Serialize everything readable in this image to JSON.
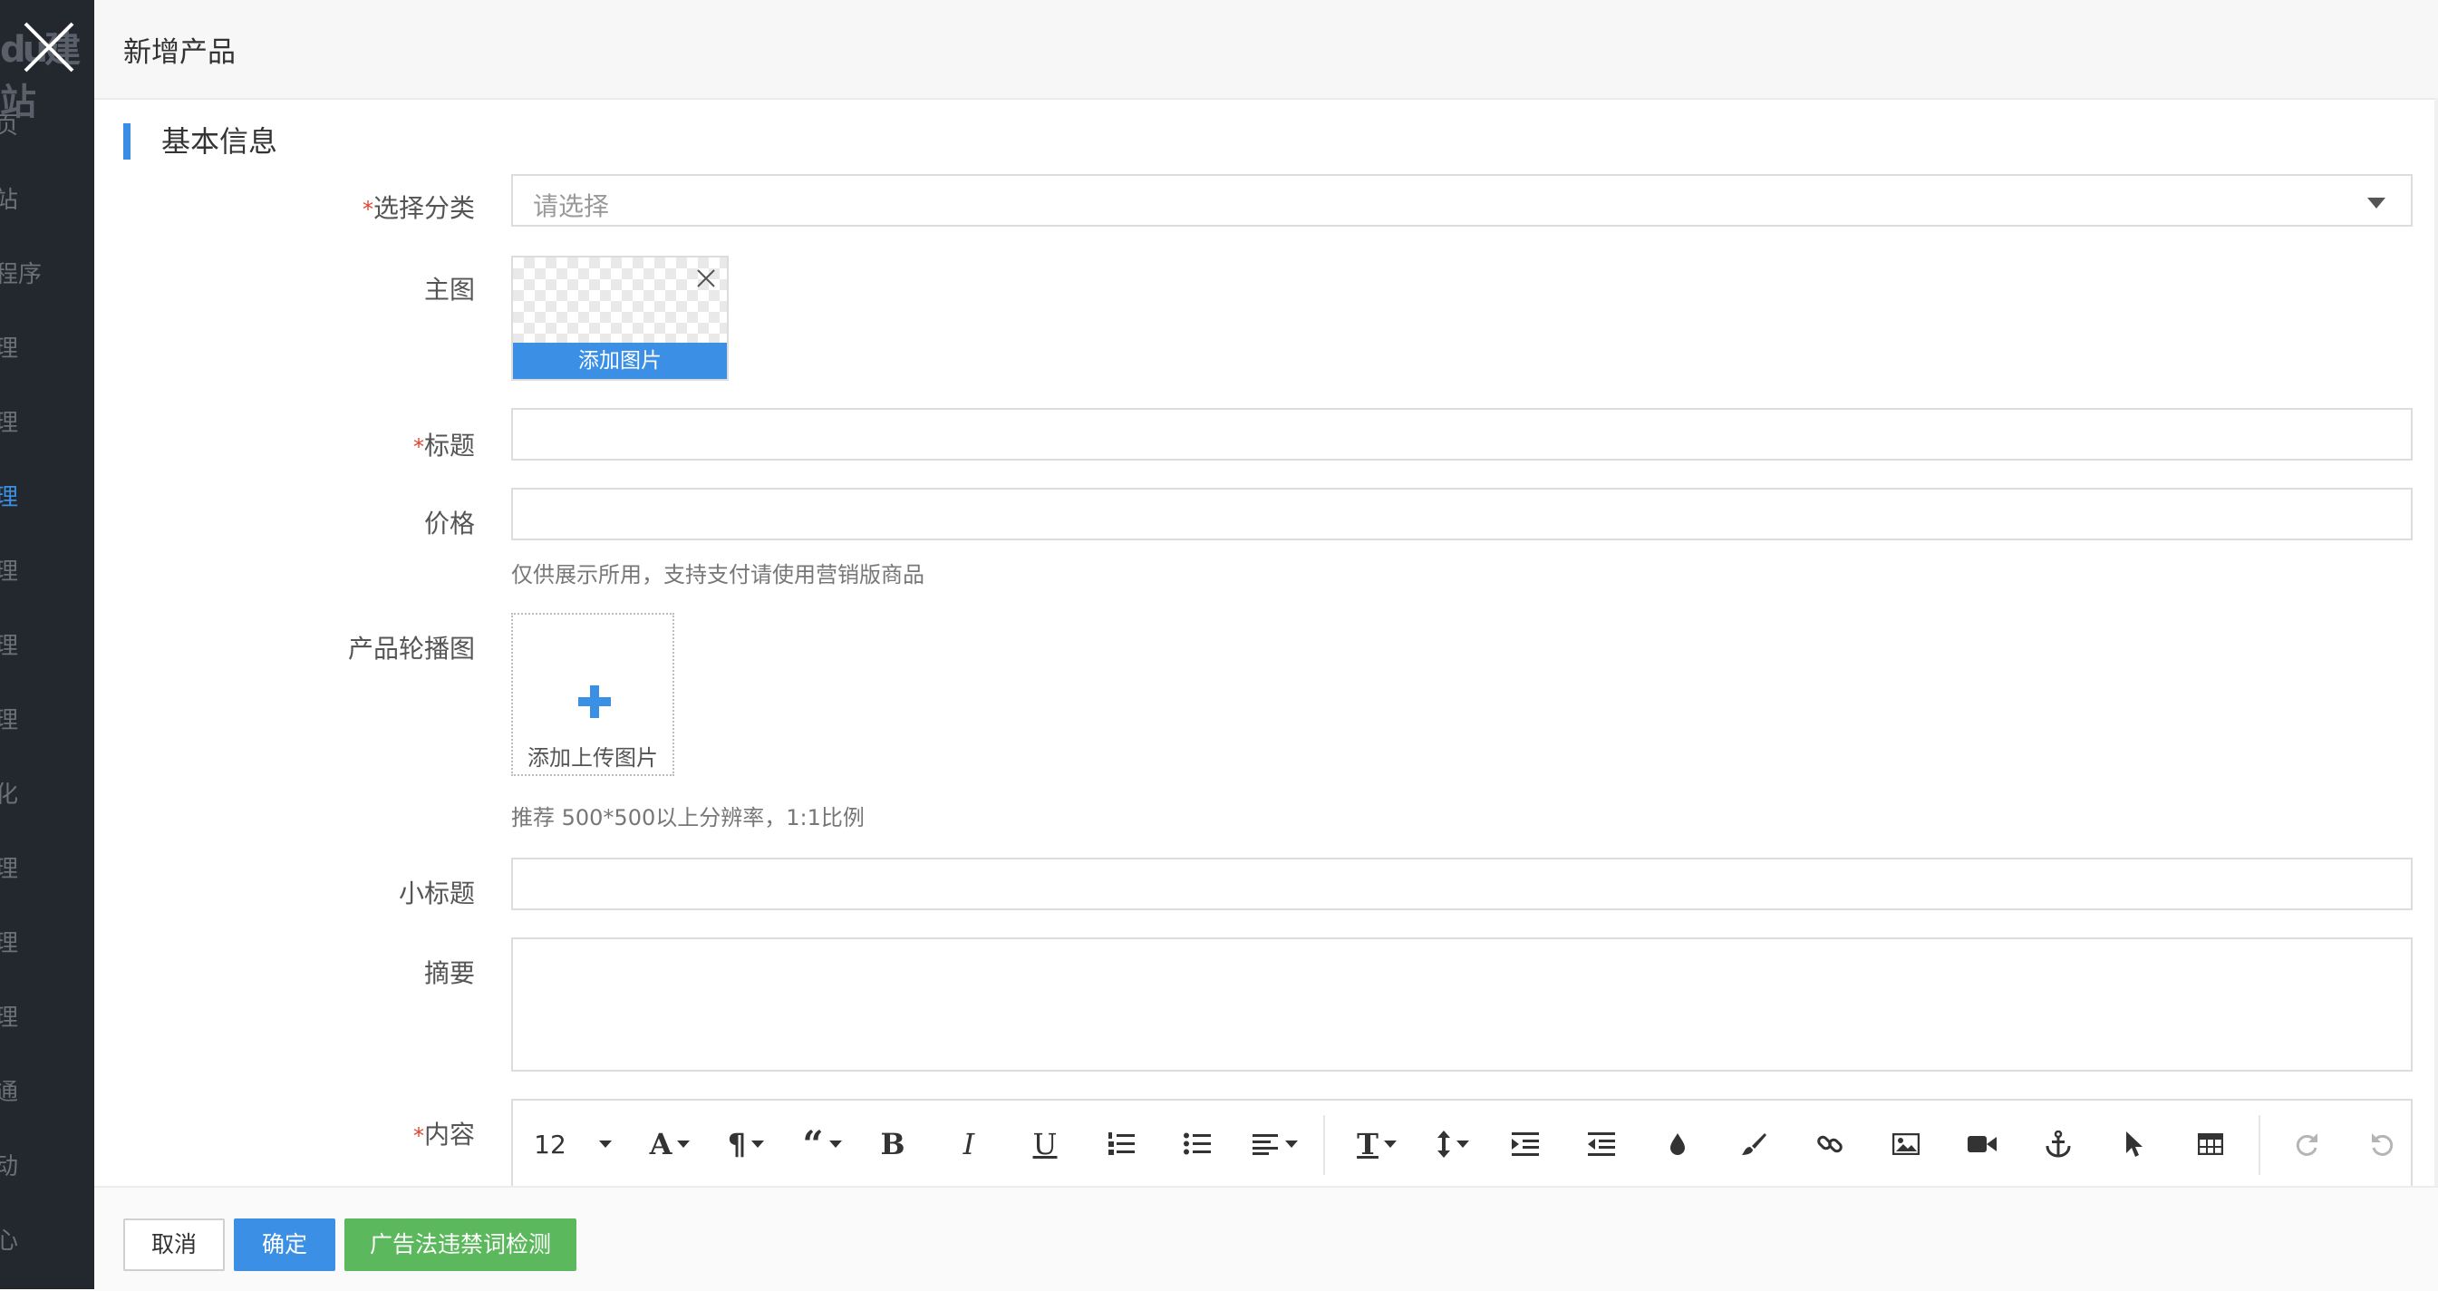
{
  "sidebar": {
    "logo": "du建站",
    "items": [
      "页",
      "站",
      "程序",
      "理",
      "理",
      "理",
      "理",
      "理",
      "理",
      "化",
      "理",
      "理",
      "理",
      "通",
      "动",
      "心"
    ],
    "active_index": 5
  },
  "modal": {
    "title": "新增产品",
    "section_title": "基本信息",
    "fields": {
      "category": {
        "label": "选择分类",
        "required": "*",
        "placeholder": "请选择"
      },
      "main_image": {
        "label": "主图",
        "button": "添加图片"
      },
      "title": {
        "label": "标题",
        "required": "*",
        "value": ""
      },
      "price": {
        "label": "价格",
        "value": "",
        "hint": "仅供展示所用，支持支付请使用营销版商品"
      },
      "carousel": {
        "label": "产品轮播图",
        "upload_text": "添加上传图片",
        "hint": "推荐 500*500以上分辨率，1:1比例"
      },
      "subtitle": {
        "label": "小标题",
        "value": ""
      },
      "summary": {
        "label": "摘要",
        "value": ""
      },
      "content": {
        "label": "内容",
        "required": "*"
      }
    },
    "editor_toolbar": {
      "font_size": "12",
      "tools": [
        "font-size",
        "font-family",
        "paragraph",
        "quote",
        "bold",
        "italic",
        "underline",
        "ordered-list",
        "unordered-list",
        "align",
        "text-style",
        "line-height",
        "indent",
        "outdent",
        "color",
        "brush",
        "link",
        "image",
        "video",
        "anchor",
        "select",
        "table",
        "redo",
        "undo"
      ]
    },
    "footer": {
      "cancel": "取消",
      "confirm": "确定",
      "check": "广告法违禁词检测"
    }
  },
  "colors": {
    "primary": "#3b8fe5",
    "success": "#5bb85d",
    "required": "#e3432d",
    "sidebar": "#23272e"
  }
}
